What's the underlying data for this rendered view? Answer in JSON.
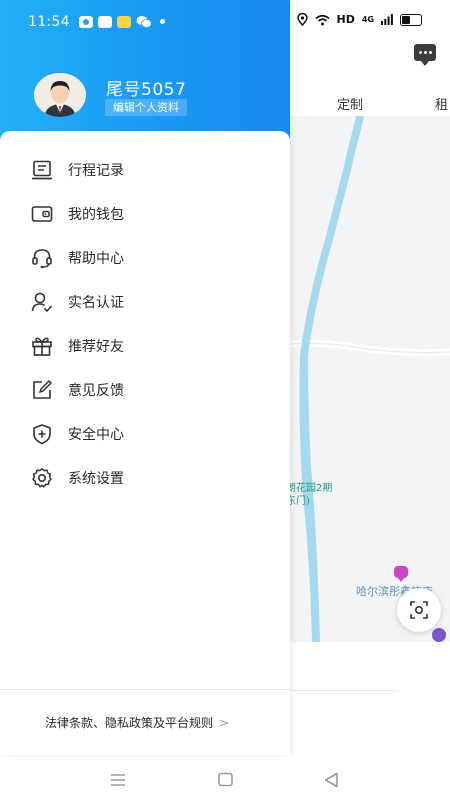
{
  "status_bar": {
    "time": "11:54",
    "network": "HD",
    "signal": "4G"
  },
  "profile": {
    "name": "尾号5057",
    "edit_label": "编辑个人资料"
  },
  "menu": {
    "items": [
      {
        "label": "行程记录",
        "icon": "trip-record-icon"
      },
      {
        "label": "我的钱包",
        "icon": "wallet-icon"
      },
      {
        "label": "帮助中心",
        "icon": "headset-icon"
      },
      {
        "label": "实名认证",
        "icon": "user-verify-icon"
      },
      {
        "label": "推荐好友",
        "icon": "gift-icon"
      },
      {
        "label": "意见反馈",
        "icon": "feedback-edit-icon"
      },
      {
        "label": "安全中心",
        "icon": "shield-icon"
      },
      {
        "label": "系统设置",
        "icon": "gear-icon"
      }
    ]
  },
  "footer": {
    "legal_label": "法律条款、隐私政策及平台规则",
    "chevron": ">"
  },
  "background_app": {
    "tabs": [
      "定制",
      "租"
    ],
    "map_labels": {
      "garden_line1": "朗花园2期",
      "garden_line2": "东门)",
      "hotel": "哈尔滨彤鑫旅店"
    }
  },
  "colors": {
    "header_gradient_start": "#22b1f6",
    "header_gradient_end": "#1788ef",
    "river": "#a5d9f0"
  }
}
